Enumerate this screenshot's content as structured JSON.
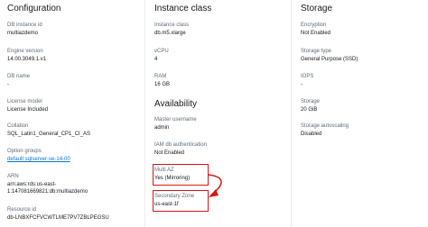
{
  "configuration": {
    "title": "Configuration",
    "fields": [
      {
        "key": "DB instance id",
        "value": "multiazdemo"
      },
      {
        "key": "Engine version",
        "value": "14.00.3049.1.v1"
      },
      {
        "key": "DB name",
        "value": "-"
      },
      {
        "key": "License model",
        "value": "License Included"
      },
      {
        "key": "Collation",
        "value": "SQL_Latin1_General_CP1_CI_AS"
      },
      {
        "key": "Option groups",
        "value": "default:sqlserver-se-14-00"
      },
      {
        "key": "ARN",
        "value": "arn:aws:rds:us-east-1:147081669821:db:multiazdemo"
      },
      {
        "key": "Resource id",
        "value": "db-LNBXFCFVCWTLME7PV7ZBLPEGSU"
      }
    ]
  },
  "instance_class": {
    "title": "Instance class",
    "fields": [
      {
        "key": "Instance class",
        "value": "db.m5.xlarge"
      },
      {
        "key": "vCPU",
        "value": "4"
      },
      {
        "key": "RAM",
        "value": "16 GB"
      }
    ]
  },
  "availability": {
    "title": "Availability",
    "fields": [
      {
        "key": "Master username",
        "value": "admin"
      },
      {
        "key": "IAM db authentication",
        "value": "Not Enabled"
      },
      {
        "key": "Multi AZ",
        "value": "Yes (Mirroring)"
      },
      {
        "key": "Secondary Zone",
        "value": "us-east-1f"
      }
    ]
  },
  "storage": {
    "title": "Storage",
    "fields": [
      {
        "key": "Encryption",
        "value": "Not Enabled"
      },
      {
        "key": "Storage type",
        "value": "General Purpose (SSD)"
      },
      {
        "key": "IOPS",
        "value": "-"
      },
      {
        "key": "Storage",
        "value": "20 GiB"
      },
      {
        "key": "Storage autoscaling",
        "value": "Disabled"
      }
    ]
  },
  "colors": {
    "highlight": "#d91515",
    "link": "#0972d3"
  }
}
